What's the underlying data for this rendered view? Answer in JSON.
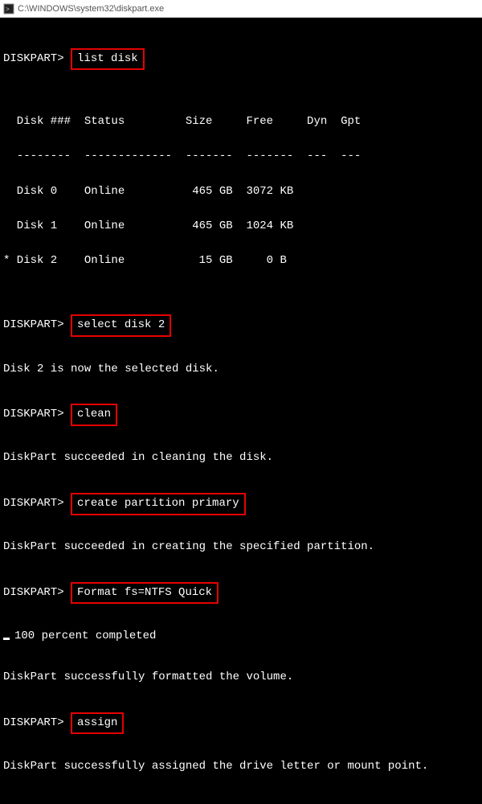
{
  "window": {
    "title": "C:\\WINDOWS\\system32\\diskpart.exe"
  },
  "prompt": "DISKPART>",
  "commands": {
    "c1": "list disk",
    "c2": "select disk 2",
    "c3": "clean",
    "c4": "create partition primary",
    "c5": "Format fs=NTFS Quick",
    "c6": "assign"
  },
  "table": {
    "header": "  Disk ###  Status         Size     Free     Dyn  Gpt",
    "divider": "  --------  -------------  -------  -------  ---  ---",
    "row0": "  Disk 0    Online          465 GB  3072 KB",
    "row1": "  Disk 1    Online          465 GB  1024 KB",
    "row2": "* Disk 2    Online           15 GB     0 B"
  },
  "outputs": {
    "o1": "Disk 2 is now the selected disk.",
    "o2": "DiskPart succeeded in cleaning the disk.",
    "o3": "DiskPart succeeded in creating the specified partition.",
    "o4": "100 percent completed",
    "o5": "DiskPart successfully formatted the volume.",
    "o6": "DiskPart successfully assigned the drive letter or mount point."
  }
}
